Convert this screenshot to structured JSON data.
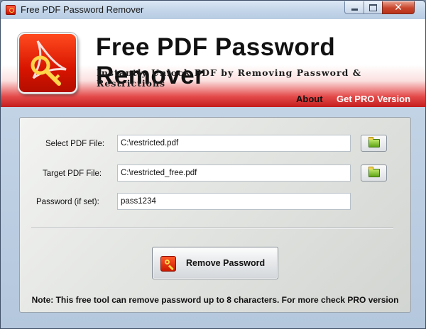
{
  "window": {
    "title": "Free PDF Password Remover"
  },
  "banner": {
    "title": "Free PDF Password Remover",
    "subtitle": "Instantly Unlock PDF by Removing Password & Restrictions",
    "nav": {
      "about": "About",
      "pro": "Get PRO Version"
    }
  },
  "form": {
    "select_label": "Select PDF File:",
    "select_value": "C:\\restricted.pdf",
    "target_label": "Target PDF File:",
    "target_value": "C:\\restricted_free.pdf",
    "password_label": "Password (if set):",
    "password_value": "pass1234",
    "remove_button": "Remove Password"
  },
  "note": "Note: This free tool can remove password up to 8 characters. For more check PRO version",
  "icons": {
    "app": "pdf-key-icon",
    "browse": "folder-open-icon",
    "remove": "pdf-key-icon",
    "minimize": "minimize-icon",
    "maximize": "maximize-icon",
    "close": "close-icon"
  },
  "colors": {
    "banner_red": "#c41d1d",
    "pro_link": "#ffffff",
    "logo_red": "#d81400"
  }
}
